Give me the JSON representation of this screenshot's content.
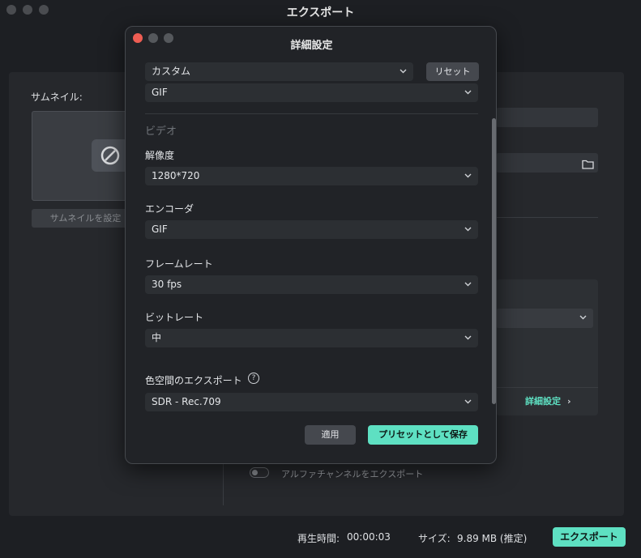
{
  "window": {
    "title": "エクスポート",
    "thumbnail_label": "サムネイル:",
    "thumbnail_button": "サムネイルを設定",
    "detail_link": "詳細設定",
    "detail_arrow": "›",
    "alpha_label": "アルファチャンネルをエクスポート",
    "duration_label": "再生時間:",
    "duration_value": "00:00:03",
    "size_label": "サイズ:",
    "size_value": "9.89 MB (推定)",
    "export_button": "エクスポート"
  },
  "dialog": {
    "title": "詳細設定",
    "preset_select": "カスタム",
    "reset_button": "リセット",
    "format_select": "GIF",
    "section_video": "ビデオ",
    "resolution_label": "解像度",
    "resolution_value": "1280*720",
    "encoder_label": "エンコーダ",
    "encoder_value": "GIF",
    "framerate_label": "フレームレート",
    "framerate_value": "30 fps",
    "bitrate_label": "ビットレート",
    "bitrate_value": "中",
    "colorspace_label": "色空間のエクスポート",
    "colorspace_value": "SDR - Rec.709",
    "help_icon": "?",
    "apply_button": "適用",
    "save_preset_button": "プリセットとして保存"
  },
  "colors": {
    "accent": "#5ee0c2",
    "close_red": "#ee5d53",
    "inactive_gray": "#55585c"
  },
  "icons": [
    "no-entry-icon",
    "folder-icon",
    "chevron-down-icon",
    "help-icon",
    "chevron-right-icon"
  ]
}
